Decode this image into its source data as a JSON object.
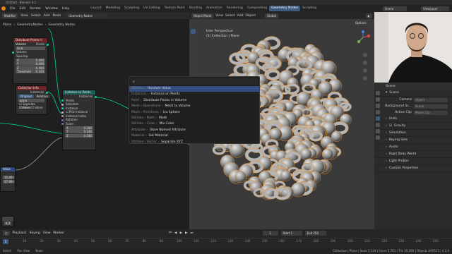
{
  "window_title": "Untitled - Blender 4.2",
  "menu": [
    "File",
    "Edit",
    "Render",
    "Window",
    "Help"
  ],
  "workspaces": [
    {
      "label": "Layout",
      "active": false
    },
    {
      "label": "Modeling",
      "active": false
    },
    {
      "label": "Sculpting",
      "active": false
    },
    {
      "label": "UV Editing",
      "active": false
    },
    {
      "label": "Texture Paint",
      "active": false
    },
    {
      "label": "Shading",
      "active": false
    },
    {
      "label": "Animation",
      "active": false
    },
    {
      "label": "Rendering",
      "active": false
    },
    {
      "label": "Compositing",
      "active": false
    },
    {
      "label": "Geometry Nodes",
      "active": true
    },
    {
      "label": "Scripting",
      "active": false
    }
  ],
  "scene_field": "Scene",
  "viewlayer_field": "ViewLayer",
  "node_editor": {
    "editor_type": "Modifier",
    "menus": [
      "View",
      "Select",
      "Add",
      "Node"
    ],
    "tree_name": "Geometry Nodes",
    "breadcrumb": [
      "Plane",
      "GeometryNodes",
      "Geometry Nodes"
    ],
    "nodes": {
      "distribute": {
        "title": "Distribute Points in Volume",
        "out": "Points",
        "mode": "Grid",
        "in_volume": "Volume",
        "spacing_label": "Spacing:",
        "x": "0.490",
        "y": "0.490",
        "z": "0.490",
        "threshold_label": "Threshold",
        "threshold": "0.100"
      },
      "collection_info": {
        "title": "Collection Info",
        "out": "Instances",
        "tab1": "Original",
        "tab2": "Relative",
        "collection": "grain",
        "separate": "Separate Children",
        "reset": "Reset Children"
      },
      "instance": {
        "title": "Instance on Points",
        "out": "Instances",
        "rows": [
          "Points",
          "Selection",
          "Instance",
          "Pick Instance",
          "Instance Index",
          "Rotation",
          "Scale:"
        ],
        "sx": "0.240",
        "sy": "0.240",
        "sz": "0.240"
      },
      "value": {
        "title": "Value",
        "v1": "15.400",
        "v2": "27.900"
      },
      "bottom": {
        "v": "4.2"
      }
    }
  },
  "search_menu": {
    "query": "",
    "items": [
      {
        "cat": "Utilities ›",
        "name": "Random Value",
        "highlight": true
      },
      {
        "cat": "Instances ›",
        "name": "Instance on Points",
        "highlight": false
      },
      {
        "cat": "Point ›",
        "name": "Distribute Points in Volume",
        "highlight": false
      },
      {
        "cat": "Mesh › Operations ›",
        "name": "Mesh to Volume",
        "highlight": false
      },
      {
        "cat": "Mesh › Primitives ›",
        "name": "Ico Sphere",
        "highlight": false
      },
      {
        "cat": "Utilities › Math ›",
        "name": "Math",
        "highlight": false
      },
      {
        "cat": "Utilities › Color ›",
        "name": "Mix Color",
        "highlight": false
      },
      {
        "cat": "Attribute ›",
        "name": "Store Named Attribute",
        "highlight": false
      },
      {
        "cat": "Material ›",
        "name": "Set Material",
        "highlight": false
      },
      {
        "cat": "Utilities › Vector ›",
        "name": "Separate XYZ",
        "highlight": false
      }
    ]
  },
  "viewport": {
    "mode": "Object Mode",
    "menus": [
      "View",
      "Select",
      "Add",
      "Object"
    ],
    "transform": "Global",
    "line1": "User Perspective",
    "line2": "(1) Collection | Plane",
    "options": "Options"
  },
  "properties": {
    "scene_label": "Scene",
    "section_scene": "Scene",
    "camera_label": "Camera",
    "camera_value": "Object",
    "bg_label": "Background Sc...",
    "bg_value": "Scene",
    "clip_label": "Active Clip",
    "clip_value": "Movie Clip",
    "panels": [
      "Units",
      "Gravity",
      "Simulation",
      "Keying Sets",
      "Audio",
      "Rigid Body World",
      "Light Probes",
      "Custom Properties"
    ]
  },
  "timeline": {
    "menus": [
      "Playback",
      "Keying",
      "View",
      "Marker"
    ],
    "frame": "1",
    "start_label": "Start",
    "start": "1",
    "end_label": "End",
    "end": "250",
    "ticks": [
      "0",
      "10",
      "20",
      "30",
      "40",
      "50",
      "60",
      "70",
      "80",
      "90",
      "100",
      "110",
      "120",
      "130",
      "140",
      "150",
      "160",
      "170",
      "180",
      "190",
      "200",
      "210",
      "220",
      "230",
      "240",
      "250"
    ]
  },
  "statusbar": {
    "items": [
      "Select",
      "Pan View",
      "Node"
    ],
    "stats": "Collection | Plane | Verts 5,134 | Faces 5,761 | Tris 10,260 | Objects 0/9/511 | 4.2.0"
  },
  "colors": {
    "accent": "#3d5a80",
    "highlight": "#334d80",
    "geometry_socket": "#00d6a3",
    "vector_socket": "#6b6ed6",
    "header_green": "#1d5f3f",
    "header_red": "#6b2323",
    "header_blue": "#2b4a78",
    "header_teal": "#1d5f5a"
  }
}
